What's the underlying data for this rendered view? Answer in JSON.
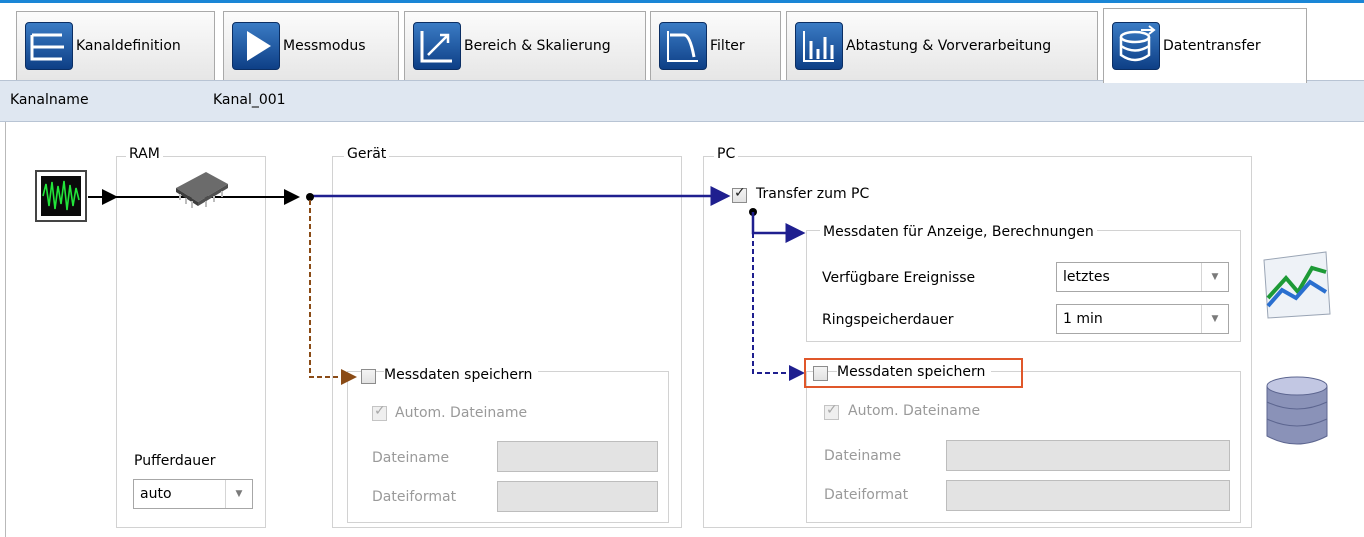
{
  "tabs": [
    {
      "label": "Kanaldefinition",
      "icon": "channel-definition-icon",
      "active": false
    },
    {
      "label": "Messmodus",
      "icon": "play-icon",
      "active": false
    },
    {
      "label": "Bereich & Skalierung",
      "icon": "scale-arrow-icon",
      "active": false
    },
    {
      "label": "Filter",
      "icon": "filter-curve-icon",
      "active": false
    },
    {
      "label": "Abtastung & Vorverarbeitung",
      "icon": "sampling-icon",
      "active": false
    },
    {
      "label": "Datentransfer",
      "icon": "database-transfer-icon",
      "active": true
    }
  ],
  "header": {
    "channel_label": "Kanalname",
    "channel_value": "Kanal_001"
  },
  "ram": {
    "title": "RAM",
    "buffer_label": "Pufferdauer",
    "buffer_value": "auto"
  },
  "device": {
    "title": "Gerät",
    "save_label": "Messdaten speichern",
    "save_checked": false,
    "auto_name_label": "Autom. Dateiname",
    "auto_name_checked": true,
    "filename_label": "Dateiname",
    "filename_value": "",
    "fileformat_label": "Dateiformat",
    "fileformat_value": ""
  },
  "pc": {
    "title": "PC",
    "transfer_label": "Transfer zum PC",
    "transfer_checked": true,
    "display_group_title": "Messdaten für Anzeige, Berechnungen",
    "events_label": "Verfügbare Ereignisse",
    "events_value": "letztes",
    "ring_label": "Ringspeicherdauer",
    "ring_value": "1 min",
    "save_label": "Messdaten speichern",
    "save_checked": false,
    "auto_name_label": "Autom. Dateiname",
    "auto_name_checked": true,
    "filename_label": "Dateiname",
    "filename_value": "",
    "fileformat_label": "Dateiformat",
    "fileformat_value": ""
  },
  "icons": {
    "source": "signal-waveform-icon",
    "ram_chip": "memory-chip-icon",
    "chart": "line-chart-icon",
    "database": "database-icon"
  },
  "colors": {
    "accent": "#1a86d6",
    "flow_main": "#1f1f8f",
    "flow_device": "#8a4b16",
    "highlight": "#e0572a",
    "header_bg": "#dfe7f1"
  }
}
